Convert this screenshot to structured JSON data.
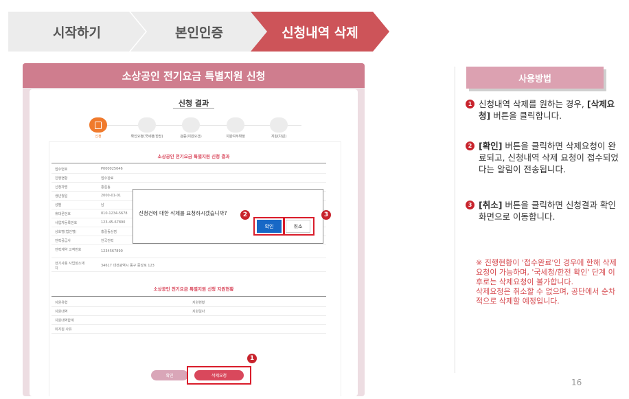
{
  "breadcrumb": {
    "steps": [
      {
        "label": "시작하기"
      },
      {
        "label": "본인인증"
      },
      {
        "label": "신청내역 삭제"
      }
    ]
  },
  "screenshot": {
    "header_title": "소상공인 전기요금 특별지원 신청",
    "card_title": "신청 결과",
    "progress_steps": [
      "신청",
      "확인요청(국세청/한전)",
      "검증(지원요건)",
      "지원여부확정",
      "지원(차감)"
    ],
    "section1_title": "소상공인 전기요금 특별지원 신청 결과",
    "rows": [
      {
        "k": "접수번호",
        "v": "P000025046"
      },
      {
        "k": "진행현황",
        "v": "접수완료"
      },
      {
        "k": "신청자명",
        "v": "홍길동"
      },
      {
        "k": "생년월일",
        "v": "2000-01-01"
      },
      {
        "k": "성별",
        "v": "남"
      },
      {
        "k": "휴대폰번호",
        "v": "010-1234-5678"
      },
      {
        "k": "사업자등록번호",
        "v": "123-45-67890"
      },
      {
        "k": "상호명(법인명)",
        "v": "홍길동상점"
      },
      {
        "k": "전력공급사",
        "v": "한국전력"
      },
      {
        "k": "전력계약 고객번호",
        "v": "1234567890"
      },
      {
        "k": "전기사용 사업장소재지",
        "v": "34617 대전광역시 동구 중앙로 123"
      }
    ],
    "dialog": {
      "message": "신청건에 대한 삭제를 요청하시겠습니까?",
      "confirm_label": "확인",
      "cancel_label": "취소"
    },
    "section2_title": "소상공인 전기요금 특별지원 신청 지원현황",
    "support_rows": [
      {
        "k1": "지원유형",
        "k2": "지원현황"
      },
      {
        "k1": "지원내역",
        "k2": "지원일자"
      },
      {
        "k1": "지원내역합계",
        "k2": ""
      },
      {
        "k1": "미지원 사유",
        "k2": ""
      }
    ],
    "bottom_buttons": {
      "confirm_label": "확인",
      "delete_label": "삭제요청"
    },
    "callouts": [
      "1",
      "2",
      "3"
    ]
  },
  "howto": {
    "title": "사용방법",
    "items": [
      {
        "num": "1",
        "pre": "신청내역 삭제를 원하는 경우, ",
        "bold": "[삭제요청]",
        "post": " 버튼을 클릭합니다."
      },
      {
        "num": "2",
        "pre": "",
        "bold": "[확인]",
        "post": " 버튼을 클릭하면 삭제요청이 완료되고, 신청내역 삭제 요청이 접수되었다는 알림이 전송됩니다."
      },
      {
        "num": "3",
        "pre": "",
        "bold": "[취소]",
        "post": " 버튼을 클릭하면 신청결과 확인 화면으로 이동합니다."
      }
    ],
    "note1": "※ 진행현황이 '접수완료'인 경우에 한해 삭제요청이 가능하며, '국세청/한전 확인' 단계 이후로는 삭제요청이 불가합니다.",
    "note2": "삭제요청은 취소할 수 없으며, 공단에서 순차적으로 삭제할 예정입니다."
  },
  "page_number": "16",
  "colors": {
    "accent": "#cd5459",
    "header_pink": "#cf7d8e",
    "callout_red": "#c8242d",
    "dialog_blue": "#1768c6"
  }
}
